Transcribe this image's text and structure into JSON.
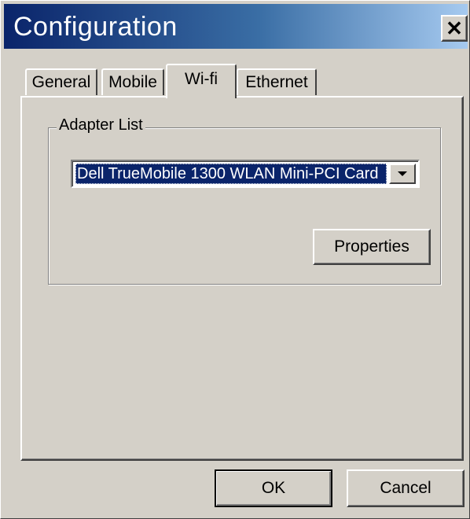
{
  "window": {
    "title": "Configuration",
    "close_symbol": "✕"
  },
  "tabs": [
    {
      "label": "General",
      "active": false
    },
    {
      "label": "Mobile",
      "active": false
    },
    {
      "label": "Wi-fi",
      "active": true
    },
    {
      "label": "Ethernet",
      "active": false
    }
  ],
  "wifi": {
    "group_label": "Adapter List",
    "adapter_selected": "Dell TrueMobile 1300 WLAN Mini-PCI Card",
    "properties_label": "Properties"
  },
  "footer": {
    "ok_label": "OK",
    "cancel_label": "Cancel"
  },
  "colors": {
    "title_gradient_start": "#0a246a",
    "title_gradient_end": "#a6caf0",
    "face": "#d4d0c8",
    "selection": "#0a246a"
  },
  "icons": {
    "close": "close-icon",
    "dropdown": "chevron-down-icon"
  }
}
